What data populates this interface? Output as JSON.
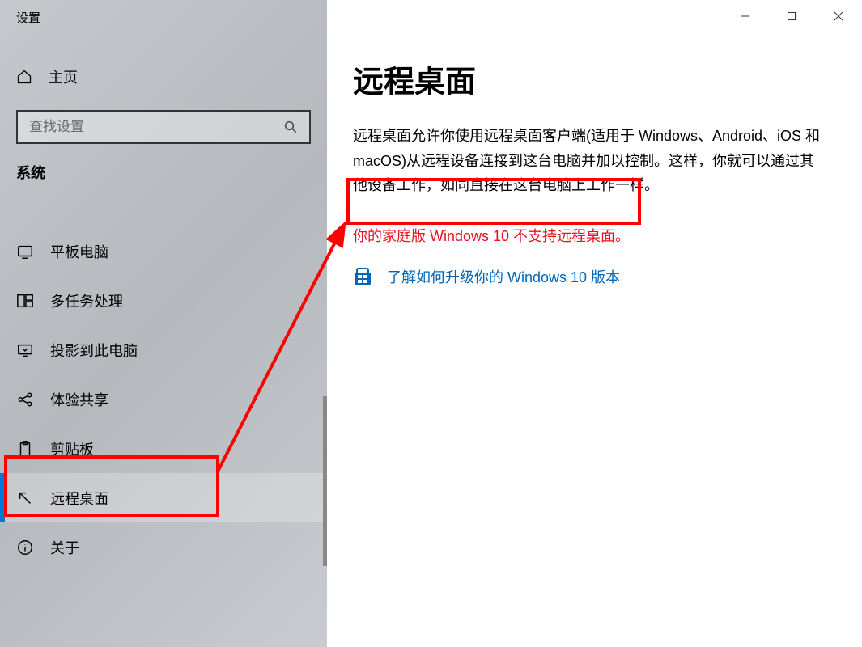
{
  "window": {
    "title": "设置"
  },
  "sidebar": {
    "home_label": "主页",
    "search_placeholder": "查找设置",
    "section_label": "系统",
    "items": [
      {
        "label": "平板电脑",
        "icon": "tablet-icon"
      },
      {
        "label": "多任务处理",
        "icon": "multitask-icon"
      },
      {
        "label": "投影到此电脑",
        "icon": "project-icon"
      },
      {
        "label": "体验共享",
        "icon": "share-icon"
      },
      {
        "label": "剪贴板",
        "icon": "clipboard-icon"
      },
      {
        "label": "远程桌面",
        "icon": "remote-icon",
        "selected": true
      },
      {
        "label": "关于",
        "icon": "about-icon"
      }
    ]
  },
  "main": {
    "title": "远程桌面",
    "description": "远程桌面允许你使用远程桌面客户端(适用于 Windows、Android、iOS 和 macOS)从远程设备连接到这台电脑并加以控制。这样，你就可以通过其他设备工作，如同直接在这台电脑上工作一样。",
    "warning": "你的家庭版 Windows 10 不支持远程桌面。",
    "link_text": "了解如何升级你的 Windows 10 版本"
  },
  "annotation": {
    "box1_color": "#ff0000",
    "box2_color": "#ff0000",
    "arrow_color": "#ff0000"
  }
}
